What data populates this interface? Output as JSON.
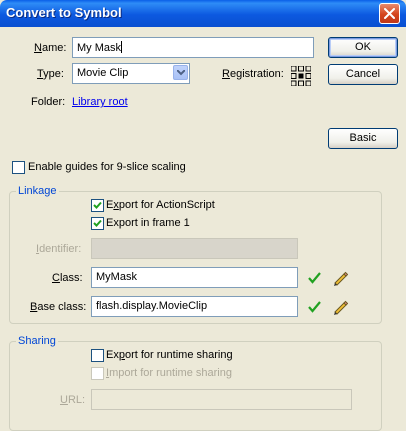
{
  "window": {
    "title": "Convert to Symbol"
  },
  "name": {
    "label": "Name:",
    "value": "My Mask"
  },
  "type": {
    "label": "Type:",
    "selected": "Movie Clip"
  },
  "registration": {
    "label": "Registration:"
  },
  "folder": {
    "label": "Folder:",
    "link": "Library root"
  },
  "buttons": {
    "ok": "OK",
    "cancel": "Cancel",
    "basic": "Basic"
  },
  "guides": {
    "label": "Enable guides for 9-slice scaling",
    "checked": false
  },
  "linkage": {
    "legend": "Linkage",
    "export_actionscript": {
      "label": "Export for ActionScript",
      "checked": true
    },
    "export_frame1": {
      "label": "Export in frame 1",
      "checked": true
    },
    "identifier": {
      "label": "Identifier:",
      "value": ""
    },
    "class": {
      "label": "Class:",
      "value": "MyMask"
    },
    "base_class": {
      "label": "Base class:",
      "value": "flash.display.MovieClip"
    }
  },
  "sharing": {
    "legend": "Sharing",
    "export_runtime": {
      "label": "Export for runtime sharing",
      "checked": false
    },
    "import_runtime": {
      "label": "Import for runtime sharing",
      "checked": false
    },
    "url": {
      "label": "URL:",
      "value": ""
    }
  },
  "colors": {
    "titlebar": "#0A5FE8",
    "group_legend": "#0046D5",
    "link": "#0000EE",
    "check_icon": "#21A121"
  },
  "icons": {
    "close": "close-icon",
    "dropdown": "chevron-down-icon",
    "registration": "registration-grid-icon",
    "validate": "checkmark-icon",
    "edit": "pencil-icon"
  }
}
